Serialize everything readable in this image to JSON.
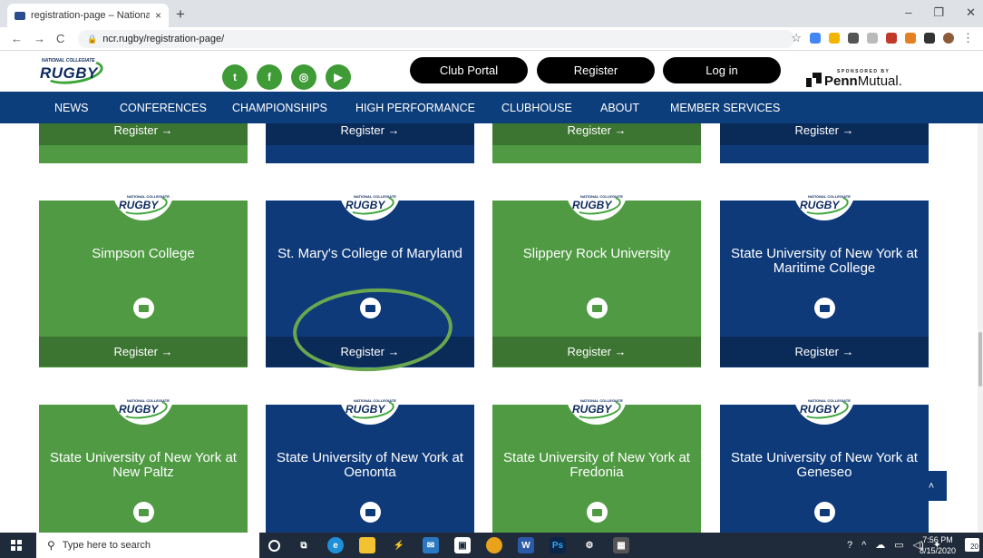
{
  "browser": {
    "tab_title": "registration-page – National Coll",
    "tab_close": "×",
    "new_tab": "+",
    "url": "ncr.rugby/registration-page/",
    "window_controls": [
      "–",
      "❐",
      "✕"
    ]
  },
  "site": {
    "logo_small": "NATIONAL COLLEGIATE",
    "logo_big": "RUGBY",
    "social": [
      {
        "name": "twitter",
        "glyph": "t"
      },
      {
        "name": "facebook",
        "glyph": "f"
      },
      {
        "name": "instagram",
        "glyph": "◎"
      },
      {
        "name": "youtube",
        "glyph": "▶"
      }
    ],
    "buttons": {
      "club_portal": "Club Portal",
      "register": "Register",
      "login": "Log in"
    },
    "sponsor": {
      "label": "SPONSORED BY",
      "brand_bold": "Penn",
      "brand_rest": "Mutual"
    }
  },
  "nav": [
    "NEWS",
    "CONFERENCES",
    "CHAMPIONSHIPS",
    "HIGH PERFORMANCE",
    "CLUBHOUSE",
    "ABOUT",
    "MEMBER SERVICES"
  ],
  "cards": {
    "register_label": "Register →",
    "top_row": [
      {
        "color": "green"
      },
      {
        "color": "blue"
      },
      {
        "color": "green"
      },
      {
        "color": "blue"
      }
    ],
    "row2": [
      {
        "name": "Simpson College",
        "color": "green"
      },
      {
        "name": "St. Mary's College of Maryland",
        "color": "blue"
      },
      {
        "name": "Slippery Rock University",
        "color": "green"
      },
      {
        "name": "State University of New York at Maritime College",
        "color": "blue"
      }
    ],
    "row3": [
      {
        "name": "State University of New York at New Paltz",
        "color": "green"
      },
      {
        "name": "State University of New York at Oenonta",
        "color": "blue"
      },
      {
        "name": "State University of New York at Fredonia",
        "color": "green"
      },
      {
        "name": "State University of New York at Geneseo",
        "color": "blue"
      }
    ]
  },
  "scroll_top_glyph": "˄",
  "taskbar": {
    "search_placeholder": "Type here to search",
    "time": "7:56 PM",
    "date": "8/15/2020",
    "notif_count": "20"
  },
  "colors": {
    "green": "#4f9a42",
    "blue": "#0e3a7a",
    "nav": "#0d3e7c",
    "annotation": "#6aa84f"
  }
}
